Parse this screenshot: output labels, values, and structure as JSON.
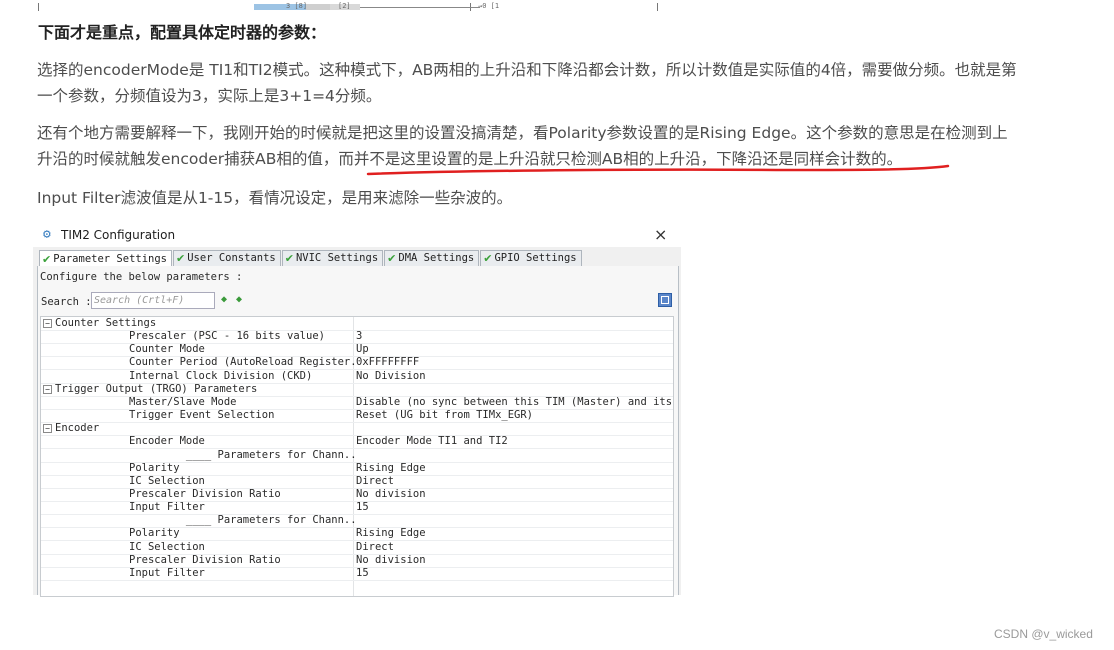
{
  "page": {
    "heading": "下面才是重点，配置具体定时器的参数：",
    "para1": "选择的encoderMode是 TI1和TI2模式。这种模式下，AB两相的上升沿和下降沿都会计数，所以计数值是实际值的4倍，需要做分频。也就是第一个参数，分频值设为3，实际上是3+1=4分频。",
    "para2": "还有个地方需要解释一下，我刚开始的时候就是把这里的设置没搞清楚，看Polarity参数设置的是Rising Edge。这个参数的意思是在检测到上升沿的时候就触发encoder捕获AB相的值，而并不是这里设置的是上升沿就只检测AB相的上升沿，下降沿还是同样会计数的。",
    "para3": "Input Filter滤波值是从1-15，看情况设定，是用来滤除一些杂波的。",
    "underline_color": "#e02020",
    "watermark": "CSDN @v_wicked"
  },
  "top_strip": {
    "mini_left": "3 [8]",
    "mini_right": "[2]",
    "mini_end": "→0 [1"
  },
  "config": {
    "title": "TIM2 Configuration",
    "close_glyph": "×",
    "gear_icon": "gear-icon",
    "tabs": [
      {
        "label": "Parameter Settings",
        "active": true
      },
      {
        "label": "User Constants",
        "active": false
      },
      {
        "label": "NVIC Settings",
        "active": false
      },
      {
        "label": "DMA Settings",
        "active": false
      },
      {
        "label": "GPIO Settings",
        "active": false
      }
    ],
    "hint": "Configure the below parameters :",
    "search_label": "Search :",
    "search_placeholder": "Search (Crtl+F)",
    "rows": [
      {
        "type": "group",
        "label": "Counter Settings"
      },
      {
        "type": "param",
        "name": "Prescaler (PSC - 16 bits value)",
        "value": "3"
      },
      {
        "type": "param",
        "name": "Counter Mode",
        "value": "Up"
      },
      {
        "type": "param",
        "name": "Counter Period (AutoReload Register...",
        "value": "0xFFFFFFFF"
      },
      {
        "type": "param",
        "name": "Internal Clock Division (CKD)",
        "value": "No Division"
      },
      {
        "type": "group",
        "label": "Trigger Output (TRGO) Parameters"
      },
      {
        "type": "param",
        "name": "Master/Slave Mode",
        "value": "Disable (no sync between this TIM (Master) and its..."
      },
      {
        "type": "param",
        "name": "Trigger Event Selection",
        "value": "Reset (UG bit from TIMx_EGR)"
      },
      {
        "type": "group",
        "label": "Encoder"
      },
      {
        "type": "param",
        "name": "Encoder Mode",
        "value": "Encoder Mode TI1 and TI2"
      },
      {
        "type": "param",
        "name": "         ____ Parameters for Chann...",
        "value": ""
      },
      {
        "type": "param",
        "name": "Polarity",
        "value": "Rising Edge"
      },
      {
        "type": "param",
        "name": "IC Selection",
        "value": "Direct"
      },
      {
        "type": "param",
        "name": "Prescaler Division Ratio",
        "value": "No division"
      },
      {
        "type": "param",
        "name": "Input Filter",
        "value": "15"
      },
      {
        "type": "param",
        "name": "         ____ Parameters for Chann...",
        "value": ""
      },
      {
        "type": "param",
        "name": "Polarity",
        "value": "Rising Edge"
      },
      {
        "type": "param",
        "name": "IC Selection",
        "value": "Direct"
      },
      {
        "type": "param",
        "name": "Prescaler Division Ratio",
        "value": "No division"
      },
      {
        "type": "param",
        "name": "Input Filter",
        "value": "15"
      }
    ]
  }
}
